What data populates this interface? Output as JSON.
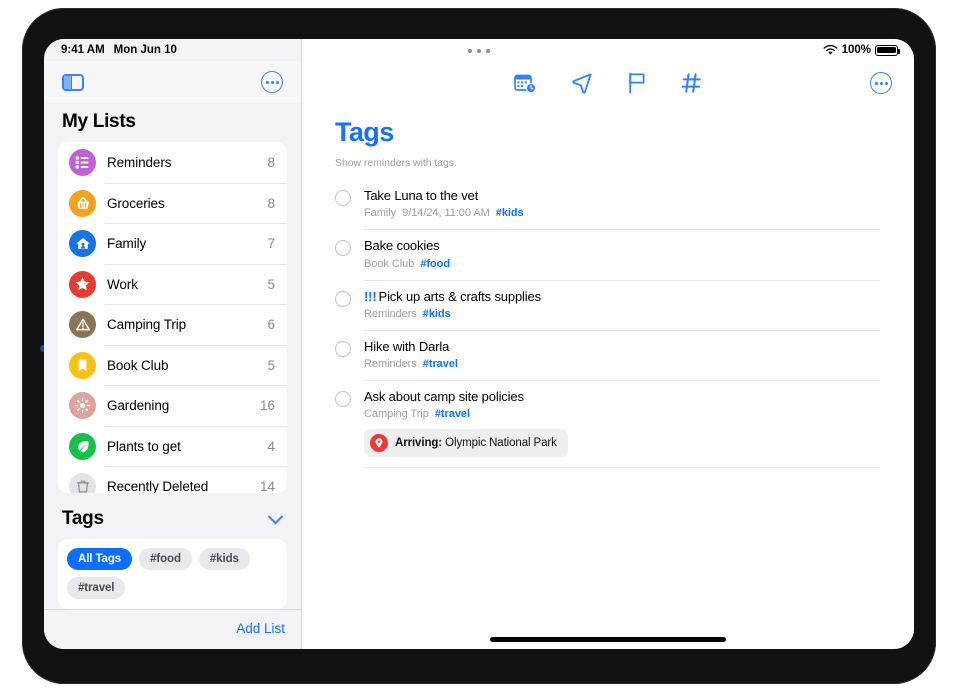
{
  "status_bar": {
    "time": "9:41 AM",
    "date": "Mon Jun 10",
    "battery_percent": "100%",
    "wifi_icon": "wifi-icon",
    "battery_icon": "battery-full-icon",
    "multitask_handle": "multitasking-dots"
  },
  "sidebar": {
    "toggle_icon": "sidebar-toggle-icon",
    "more_icon": "more-circle-icon",
    "title": "My Lists",
    "lists": [
      {
        "label": "Reminders",
        "count": "8",
        "icon": "list-bullet-icon",
        "color": "#c060d8"
      },
      {
        "label": "Groceries",
        "count": "8",
        "icon": "basket-icon",
        "color": "#f5a01e"
      },
      {
        "label": "Family",
        "count": "7",
        "icon": "house-icon",
        "color": "#1673e6"
      },
      {
        "label": "Work",
        "count": "5",
        "icon": "star-icon",
        "color": "#ea3b2e"
      },
      {
        "label": "Camping Trip",
        "count": "6",
        "icon": "tent-icon",
        "color": "#8a7458"
      },
      {
        "label": "Book Club",
        "count": "5",
        "icon": "bookmark-icon",
        "color": "#fcc013"
      },
      {
        "label": "Gardening",
        "count": "16",
        "icon": "flower-icon",
        "color": "#dda39c"
      },
      {
        "label": "Plants to get",
        "count": "4",
        "icon": "leaf-icon",
        "color": "#18bf4a"
      },
      {
        "label": "Recently Deleted",
        "count": "14",
        "icon": "trash-icon",
        "color": "#e4e4e8"
      }
    ],
    "tags_section": {
      "title": "Tags",
      "collapse_icon": "chevron-down-icon",
      "tags": [
        {
          "label": "All Tags",
          "active": true
        },
        {
          "label": "#food",
          "active": false
        },
        {
          "label": "#kids",
          "active": false
        },
        {
          "label": "#travel",
          "active": false
        }
      ]
    },
    "add_list_label": "Add List"
  },
  "content": {
    "toolbar": [
      {
        "icon": "scheduled-calendar-icon"
      },
      {
        "icon": "location-arrow-icon"
      },
      {
        "icon": "flag-icon"
      },
      {
        "icon": "hashtag-icon"
      }
    ],
    "more_icon": "more-circle-icon",
    "title": "Tags",
    "subtitle": "Show reminders with tags.",
    "reminders": [
      {
        "priority": "",
        "title": "Take Luna to the vet",
        "list": "Family",
        "datetime": "9/14/24, 11:00 AM",
        "tag": "#kids"
      },
      {
        "priority": "",
        "title": "Bake cookies",
        "list": "Book Club",
        "datetime": "",
        "tag": "#food"
      },
      {
        "priority": "!!!",
        "title": "Pick up arts & crafts supplies",
        "list": "Reminders",
        "datetime": "",
        "tag": "#kids"
      },
      {
        "priority": "",
        "title": "Hike with Darla",
        "list": "Reminders",
        "datetime": "",
        "tag": "#travel"
      },
      {
        "priority": "",
        "title": "Ask about camp site policies",
        "list": "Camping Trip",
        "datetime": "",
        "tag": "#travel",
        "location_badge": {
          "prefix": "Arriving:",
          "place": "Olympic National Park",
          "icon": "location-pin-icon"
        }
      }
    ]
  }
}
